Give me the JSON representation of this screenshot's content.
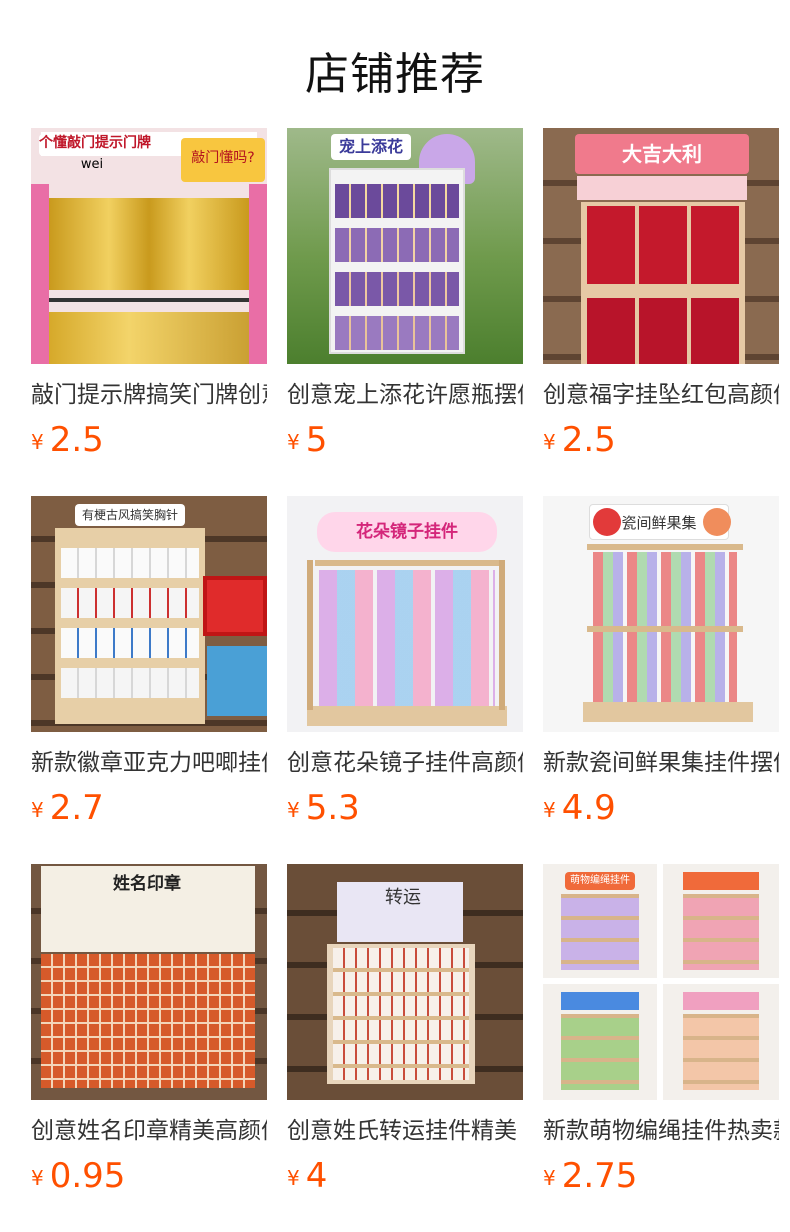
{
  "header": {
    "title": "店铺推荐"
  },
  "currency_symbol": "¥",
  "products": [
    {
      "name": "敲门提示牌搞笑门牌创意",
      "price": "2.5",
      "sign": "个懂敲门提示门牌",
      "sign2": "敲门懂吗?",
      "sign3": "wei"
    },
    {
      "name": "创意宠上添花许愿瓶摆件",
      "price": "5",
      "sign": "宠上添花"
    },
    {
      "name": "创意福字挂坠红包高颜值",
      "price": "2.5",
      "sign": "大吉大利"
    },
    {
      "name": "新款徽章亚克力吧唧挂件",
      "price": "2.7",
      "sign": "有梗古风搞笑胸针"
    },
    {
      "name": "创意花朵镜子挂件高颜值",
      "price": "5.3",
      "sign": "花朵镜子挂件"
    },
    {
      "name": "新款瓷间鲜果集挂件摆件",
      "price": "4.9",
      "sign": "瓷间鲜果集"
    },
    {
      "name": "创意姓名印章精美高颜值",
      "price": "0.95",
      "sign": "姓名印章"
    },
    {
      "name": "创意姓氏转运挂件精美",
      "price": "4",
      "sign": "转运"
    },
    {
      "name": "新款萌物编绳挂件热卖款",
      "price": "2.75",
      "sign": "萌物编绳挂件"
    }
  ],
  "colors": {
    "price": "#ff5000",
    "title": "#111111",
    "name": "#333333"
  }
}
